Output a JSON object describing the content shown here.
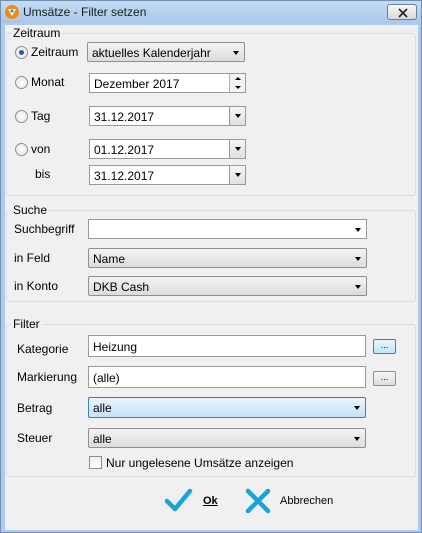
{
  "window": {
    "title": "Umsätze - Filter setzen"
  },
  "zeitraum": {
    "legend": "Zeitraum",
    "zeitraum_label": "Zeitraum",
    "zeitraum_value": "aktuelles Kalenderjahr",
    "monat_label": "Monat",
    "monat_value": "Dezember 2017",
    "tag_label": "Tag",
    "tag_value": "31.12.2017",
    "von_label": "von",
    "von_value": "01.12.2017",
    "bis_label": "bis",
    "bis_value": "31.12.2017"
  },
  "suche": {
    "legend": "Suche",
    "suchbegriff_label": "Suchbegriff",
    "suchbegriff_value": "",
    "feld_label": "in Feld",
    "feld_value": "Name",
    "konto_label": "in Konto",
    "konto_value": "DKB Cash"
  },
  "filter": {
    "legend": "Filter",
    "kategorie_label": "Kategorie",
    "kategorie_value": "Heizung",
    "markierung_label": "Markierung",
    "markierung_value": "(alle)",
    "betrag_label": "Betrag",
    "betrag_value": "alle",
    "steuer_label": "Steuer",
    "steuer_value": "alle",
    "ungelesen_label": "Nur ungelesene Umsätze anzeigen",
    "ellipsis": "..."
  },
  "buttons": {
    "ok_label": "Ok",
    "cancel_label": "Abbrechen"
  },
  "colors": {
    "accent": "#1aa3d9",
    "selection": "#1c5fb0"
  }
}
